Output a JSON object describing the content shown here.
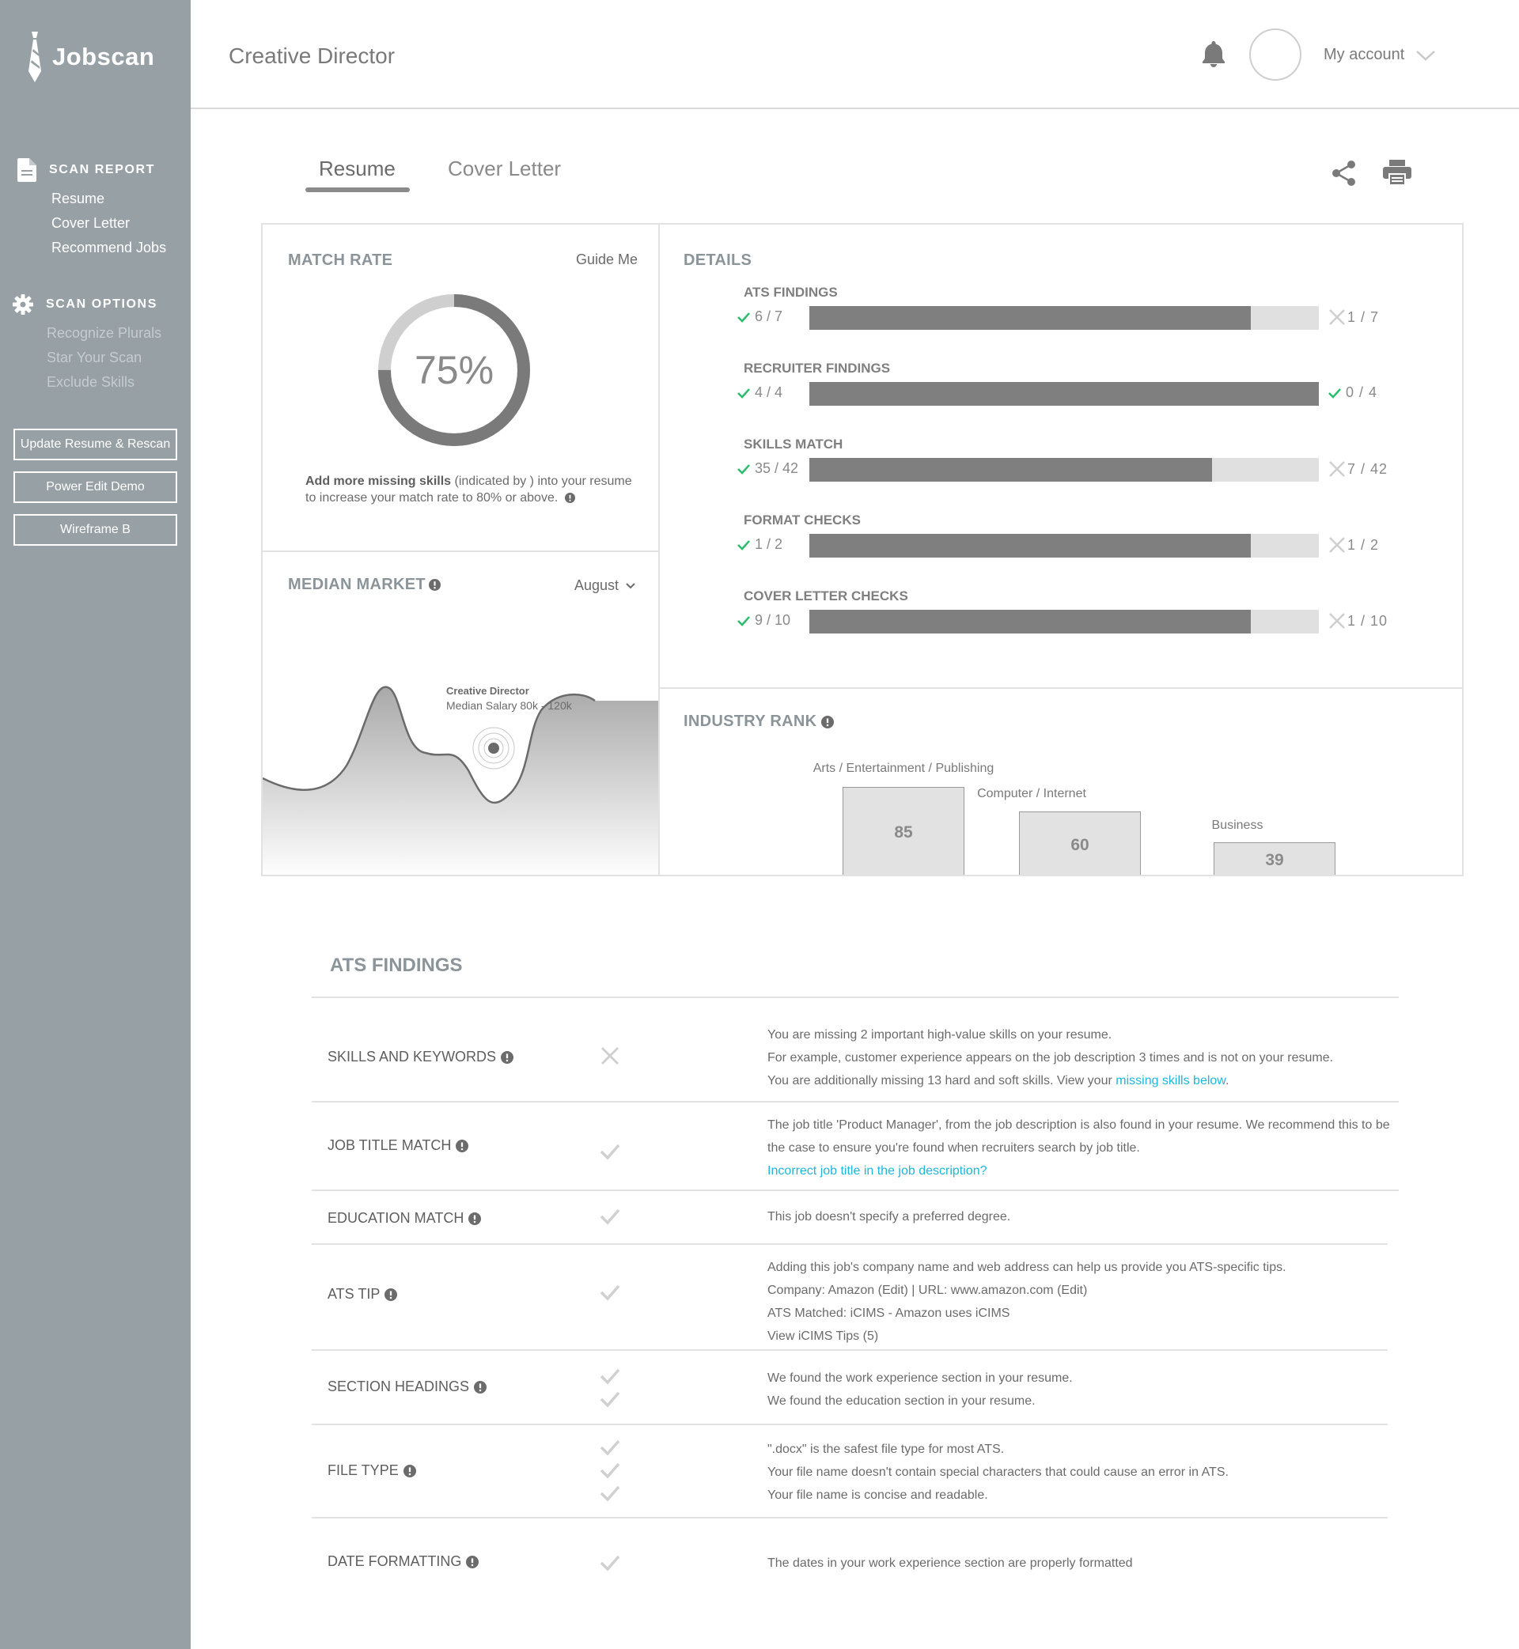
{
  "brand": {
    "name": "Jobscan"
  },
  "sidebar": {
    "scan_report": {
      "heading": "SCAN REPORT",
      "items": [
        "Resume",
        "Cover Letter",
        "Recommend Jobs"
      ]
    },
    "scan_options": {
      "heading": "SCAN OPTIONS",
      "items": [
        "Recognize Plurals",
        "Star Your Scan",
        "Exclude Skills"
      ]
    },
    "buttons": [
      "Update Resume & Rescan",
      "Power Edit Demo",
      "Wireframe B"
    ]
  },
  "header": {
    "title": "Creative Director",
    "account_label": "My account"
  },
  "tabs": [
    {
      "label": "Resume",
      "active": true
    },
    {
      "label": "Cover Letter",
      "active": false
    }
  ],
  "match_rate": {
    "title": "MATCH RATE",
    "guide_label": "Guide Me",
    "percent_text": "75%",
    "percent_value": 75,
    "hint_bold": "Add more missing skills",
    "hint_rest": " (indicated by  ) into your resume to increase your match rate to 80% or above."
  },
  "median_market": {
    "title": "MEDIAN MARKET",
    "month": "August",
    "tooltip_title": "Creative Director",
    "tooltip_value": "Median Salary 80k - 120k"
  },
  "details": {
    "title": "DETAILS",
    "metrics": [
      {
        "label": "ATS FINDINGS",
        "passed": "6 / 7",
        "failed": "1 / 7",
        "fraction": 0.866,
        "right_status": "fail"
      },
      {
        "label": "RECRUITER FINDINGS",
        "passed": "4 / 4",
        "failed": "0 / 4",
        "fraction": 1.0,
        "right_status": "pass"
      },
      {
        "label": "SKILLS MATCH",
        "passed": "35 / 42",
        "failed": "7 / 42",
        "fraction": 0.79,
        "right_status": "fail"
      },
      {
        "label": "FORMAT CHECKS",
        "passed": "1 / 2",
        "failed": "1 / 2",
        "fraction": 0.866,
        "right_status": "fail"
      },
      {
        "label": "COVER LETTER CHECKS",
        "passed": "9 / 10",
        "failed": "1 / 10",
        "fraction": 0.866,
        "right_status": "fail"
      }
    ]
  },
  "industry_rank": {
    "title": "INDUSTRY RANK",
    "industries": [
      {
        "label": "Arts / Entertainment / Publishing",
        "value": "85"
      },
      {
        "label": "Computer / Internet",
        "value": "60"
      },
      {
        "label": "Business",
        "value": "39"
      }
    ]
  },
  "ats_findings": {
    "title": "ATS FINDINGS",
    "rows": [
      {
        "name": "SKILLS AND KEYWORDS",
        "status": [
          "fail"
        ],
        "lines": [
          "You are missing 2 important high-value skills on your resume.",
          "For example, customer experience appears on the job description 3 times and is not on your resume."
        ],
        "last_line_text": "You are additionally missing 13 hard and soft skills. View your ",
        "last_line_link": "missing skills below",
        "last_line_end": "."
      },
      {
        "name": "JOB TITLE MATCH",
        "status": [
          "pass"
        ],
        "lines": [
          "The job title 'Product Manager', from the job description is also found in your resume. We recommend this to be",
          "the case to ensure you're found when recruiters search by job title."
        ],
        "link": "Incorrect job title in the job description?"
      },
      {
        "name": "EDUCATION MATCH",
        "status": [
          "pass"
        ],
        "lines": [
          "This job doesn't specify a preferred degree."
        ]
      },
      {
        "name": "ATS TIP",
        "status": [
          "pass"
        ],
        "lines": [
          "Adding this job's company name and web address can help us provide you ATS-specific tips.",
          "Company: Amazon (Edit) | URL: www.amazon.com (Edit)",
          "ATS Matched: iCIMS - Amazon uses iCIMS",
          "View iCIMS Tips (5)"
        ]
      },
      {
        "name": "SECTION HEADINGS",
        "status": [
          "pass",
          "pass"
        ],
        "lines": [
          "We found the work experience section in your resume.",
          "We found the education section in your resume."
        ]
      },
      {
        "name": "FILE TYPE",
        "status": [
          "pass",
          "pass",
          "pass"
        ],
        "lines": [
          "\".docx\" is the safest file type for most ATS.",
          "Your file name doesn't contain special characters that could cause an error in ATS.",
          "Your file name is concise and readable."
        ]
      },
      {
        "name": "DATE FORMATTING",
        "status": [
          "pass"
        ],
        "lines": [
          "The dates in your work experience section are properly formatted"
        ]
      }
    ]
  },
  "colors": {
    "sidebar_bg": "#97a1a5",
    "bar_fill": "#7f7f7f",
    "bar_track": "#e0e0e0",
    "pass_green": "#2dbd6e",
    "link_blue": "#1fb6d8",
    "muted_check": "#d0d0d0"
  }
}
